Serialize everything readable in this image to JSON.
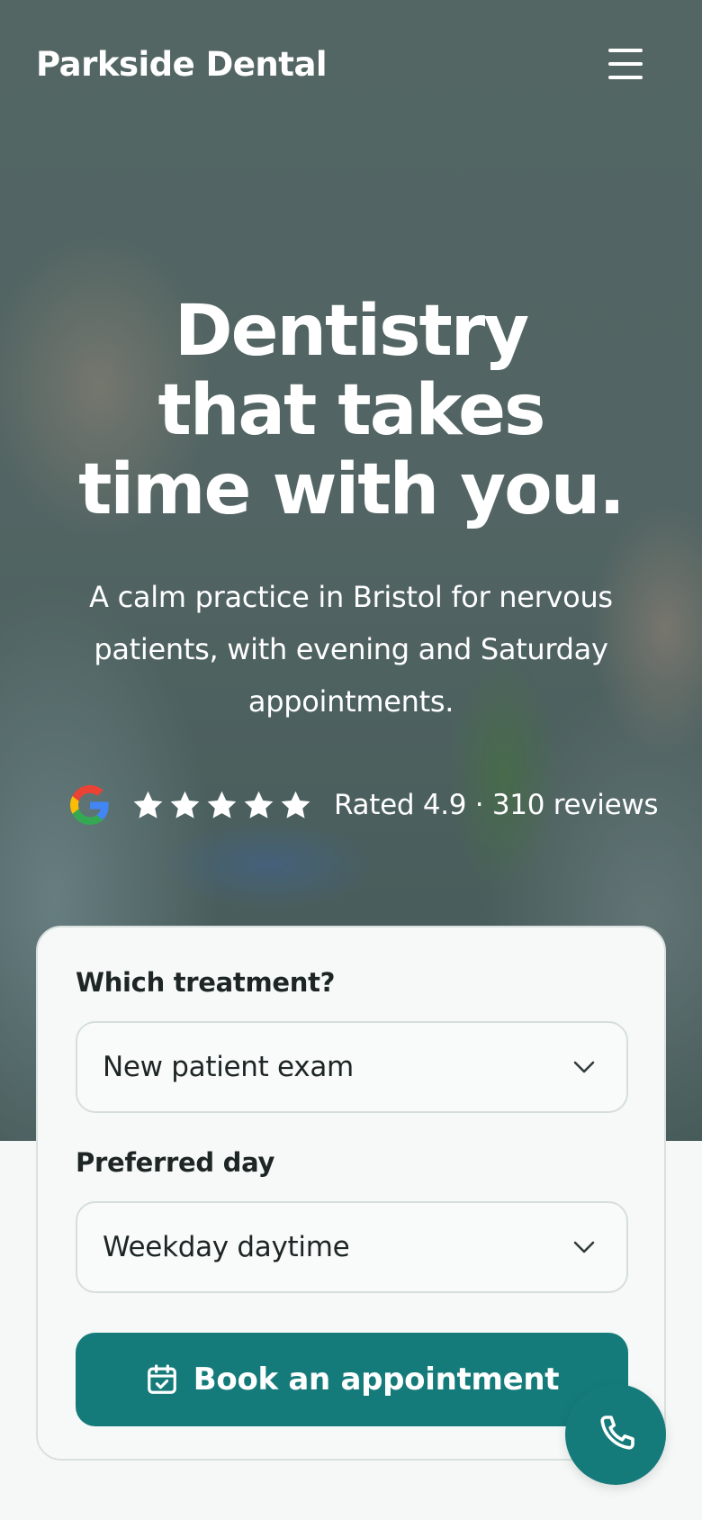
{
  "header": {
    "brand": "Parkside Dental",
    "menu_icon": "hamburger-menu-icon"
  },
  "hero": {
    "headline_lines": [
      "Dentistry",
      "that takes",
      "time with you."
    ],
    "subheading_lines": [
      "A calm practice in Bristol for nervous",
      "patients, with evening and Saturday",
      "appointments."
    ],
    "rating": {
      "source_icon": "google-logo-icon",
      "stars": 5,
      "text": "Rated 4.9 · 310 reviews"
    }
  },
  "booking_form": {
    "treatment": {
      "label": "Which treatment?",
      "selected": "New patient exam"
    },
    "day": {
      "label": "Preferred day",
      "selected": "Weekday daytime"
    },
    "submit": {
      "label": "Book an appointment",
      "icon": "calendar-check-icon"
    }
  },
  "call_button": {
    "icon": "phone-icon"
  },
  "colors": {
    "accent": "#157b7a",
    "text_dark": "#1e2525",
    "card_bg": "#f6f9f8"
  }
}
